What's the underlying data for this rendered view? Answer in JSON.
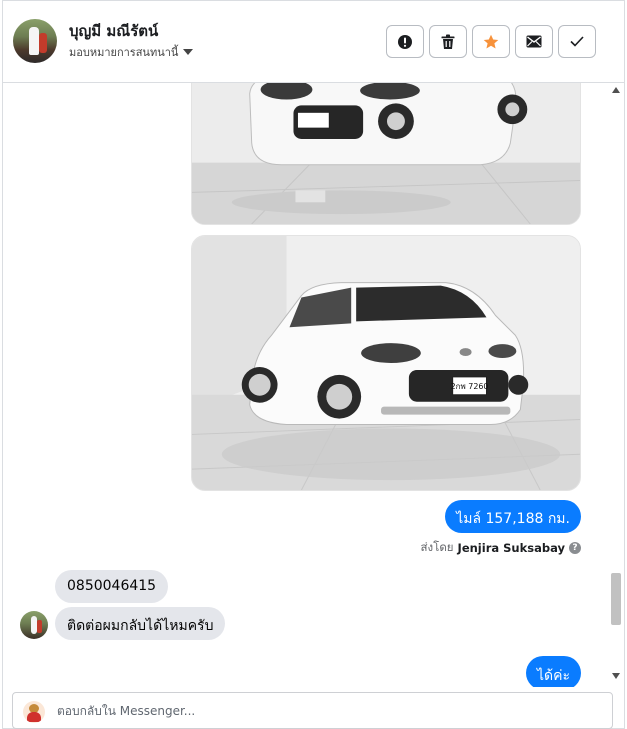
{
  "header": {
    "contact_name": "บุญมี มณีรัตน์",
    "assign_label": "มอบหมายการสนทนานี้",
    "actions": [
      {
        "icon": "alert-icon"
      },
      {
        "icon": "trash-icon"
      },
      {
        "icon": "star-icon",
        "color": "#f7923b"
      },
      {
        "icon": "mail-icon"
      },
      {
        "icon": "check-icon"
      }
    ]
  },
  "thread": {
    "images": [
      {
        "plate": "2กพ 7260"
      },
      {
        "plate": "2กพ 7260"
      }
    ],
    "mileage_message": "ไมล์ 157,188 กม.",
    "sent_by_prefix": "ส่งโดย",
    "sent_by_name": "Jenjira Suksabay",
    "phone_message": "0850046415",
    "callback_message": "ติดต่อผมกลับได้ไหมครับ",
    "reply_message": "ได้ค่ะ"
  },
  "composer": {
    "placeholder": "ตอบกลับใน Messenger..."
  },
  "colors": {
    "outgoing_bubble": "#0a7cff",
    "incoming_bubble": "#e4e6eb",
    "star": "#f7923b"
  }
}
